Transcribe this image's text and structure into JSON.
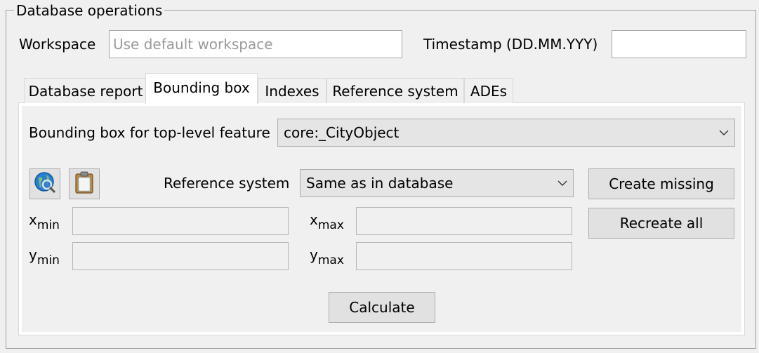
{
  "group": {
    "title": "Database operations"
  },
  "workspace": {
    "label": "Workspace",
    "placeholder": "Use default workspace",
    "value": ""
  },
  "timestamp": {
    "label": "Timestamp (DD.MM.YYY)",
    "value": ""
  },
  "tabs": [
    {
      "label": "Database report",
      "active": false
    },
    {
      "label": "Bounding box",
      "active": true
    },
    {
      "label": "Indexes",
      "active": false
    },
    {
      "label": "Reference system",
      "active": false
    },
    {
      "label": "ADEs",
      "active": false
    }
  ],
  "bbox": {
    "feature_label": "Bounding box for top-level feature",
    "feature_value": "core:_CityObject",
    "refsys_label": "Reference system",
    "refsys_value": "Same as in database",
    "create_missing": "Create missing",
    "recreate_all": "Recreate all",
    "calculate": "Calculate",
    "xmin": {
      "base": "x",
      "sub": "min",
      "value": ""
    },
    "xmax": {
      "base": "x",
      "sub": "max",
      "value": ""
    },
    "ymin": {
      "base": "y",
      "sub": "min",
      "value": ""
    },
    "ymax": {
      "base": "y",
      "sub": "max",
      "value": ""
    },
    "icons": [
      "map-globe-icon",
      "clipboard-icon"
    ]
  }
}
